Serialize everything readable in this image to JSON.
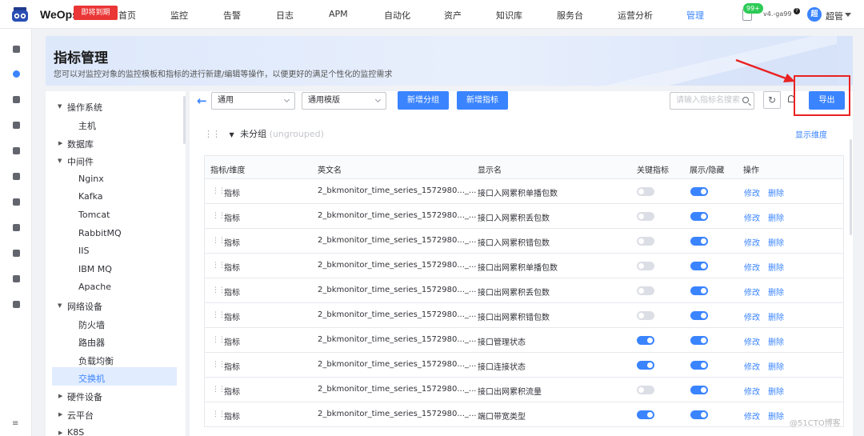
{
  "topbar": {
    "brand": "WeOps",
    "promo": "即将到期",
    "nav": [
      "首页",
      "监控",
      "告警",
      "日志",
      "APM",
      "自动化",
      "资产",
      "知识库",
      "服务台",
      "运营分析",
      "管理"
    ],
    "active_nav": "管理",
    "badge": "99+",
    "version": "v4.-ga99",
    "help": "?",
    "avatar": "超",
    "user": "超管"
  },
  "banner": {
    "title": "指标管理",
    "desc": "您可以对监控对象的监控模板和指标的进行新建/编辑等操作，以便更好的满足个性化的监控需求"
  },
  "tree": {
    "items": [
      {
        "label": "操作系统",
        "level": 0,
        "expanded": true
      },
      {
        "label": "主机",
        "level": 1
      },
      {
        "label": "数据库",
        "level": 0,
        "expanded": false
      },
      {
        "label": "中间件",
        "level": 0,
        "expanded": true
      },
      {
        "label": "Nginx",
        "level": 1
      },
      {
        "label": "Kafka",
        "level": 1
      },
      {
        "label": "Tomcat",
        "level": 1
      },
      {
        "label": "RabbitMQ",
        "level": 1
      },
      {
        "label": "IIS",
        "level": 1
      },
      {
        "label": "IBM MQ",
        "level": 1
      },
      {
        "label": "Apache",
        "level": 1
      },
      {
        "label": "网络设备",
        "level": 0,
        "expanded": true
      },
      {
        "label": "防火墙",
        "level": 1
      },
      {
        "label": "路由器",
        "level": 1
      },
      {
        "label": "负载均衡",
        "level": 1
      },
      {
        "label": "交换机",
        "level": 1,
        "selected": true
      },
      {
        "label": "硬件设备",
        "level": 0,
        "expanded": false
      },
      {
        "label": "云平台",
        "level": 0,
        "expanded": false
      },
      {
        "label": "K8S",
        "level": 0,
        "expanded": false
      }
    ]
  },
  "toolbar": {
    "select1": "通用",
    "select2": "通用模版",
    "add_group": "新增分组",
    "add_metric": "新增指标",
    "search_placeholder": "请输入指标名搜索",
    "export": "导出"
  },
  "group": {
    "name": "未分组",
    "sub": "(ungrouped)",
    "show_dim": "显示维度"
  },
  "table": {
    "headers": [
      "指标/维度",
      "英文名",
      "显示名",
      "关键指标",
      "展示/隐藏",
      "操作"
    ],
    "edit_label": "修改",
    "delete_label": "删除",
    "rows": [
      {
        "type": "指标",
        "en": "2_bkmonitor_time_series_1572980..._...",
        "name": "接口入网累积单播包数",
        "key": false,
        "show": true
      },
      {
        "type": "指标",
        "en": "2_bkmonitor_time_series_1572980..._...",
        "name": "接口入网累积丢包数",
        "key": false,
        "show": true
      },
      {
        "type": "指标",
        "en": "2_bkmonitor_time_series_1572980..._...",
        "name": "接口入网累积错包数",
        "key": false,
        "show": true
      },
      {
        "type": "指标",
        "en": "2_bkmonitor_time_series_1572980..._...",
        "name": "接口出网累积单播包数",
        "key": false,
        "show": true
      },
      {
        "type": "指标",
        "en": "2_bkmonitor_time_series_1572980..._...",
        "name": "接口出网累积丢包数",
        "key": false,
        "show": true
      },
      {
        "type": "指标",
        "en": "2_bkmonitor_time_series_1572980..._...",
        "name": "接口出网累积错包数",
        "key": false,
        "show": true
      },
      {
        "type": "指标",
        "en": "2_bkmonitor_time_series_1572980..._...",
        "name": "接口管理状态",
        "key": true,
        "show": true
      },
      {
        "type": "指标",
        "en": "2_bkmonitor_time_series_1572980..._...",
        "name": "接口连接状态",
        "key": true,
        "show": true
      },
      {
        "type": "指标",
        "en": "2_bkmonitor_time_series_1572980..._...",
        "name": "接口出网累积流量",
        "key": false,
        "show": true
      },
      {
        "type": "指标",
        "en": "2_bkmonitor_time_series_1572980..._...",
        "name": "端口带宽类型",
        "key": true,
        "show": true
      }
    ]
  },
  "watermark": "@51CTO博客",
  "colors": {
    "accent": "#3a84ff",
    "highlight": "#ea2222",
    "promo": "#ea3636"
  }
}
